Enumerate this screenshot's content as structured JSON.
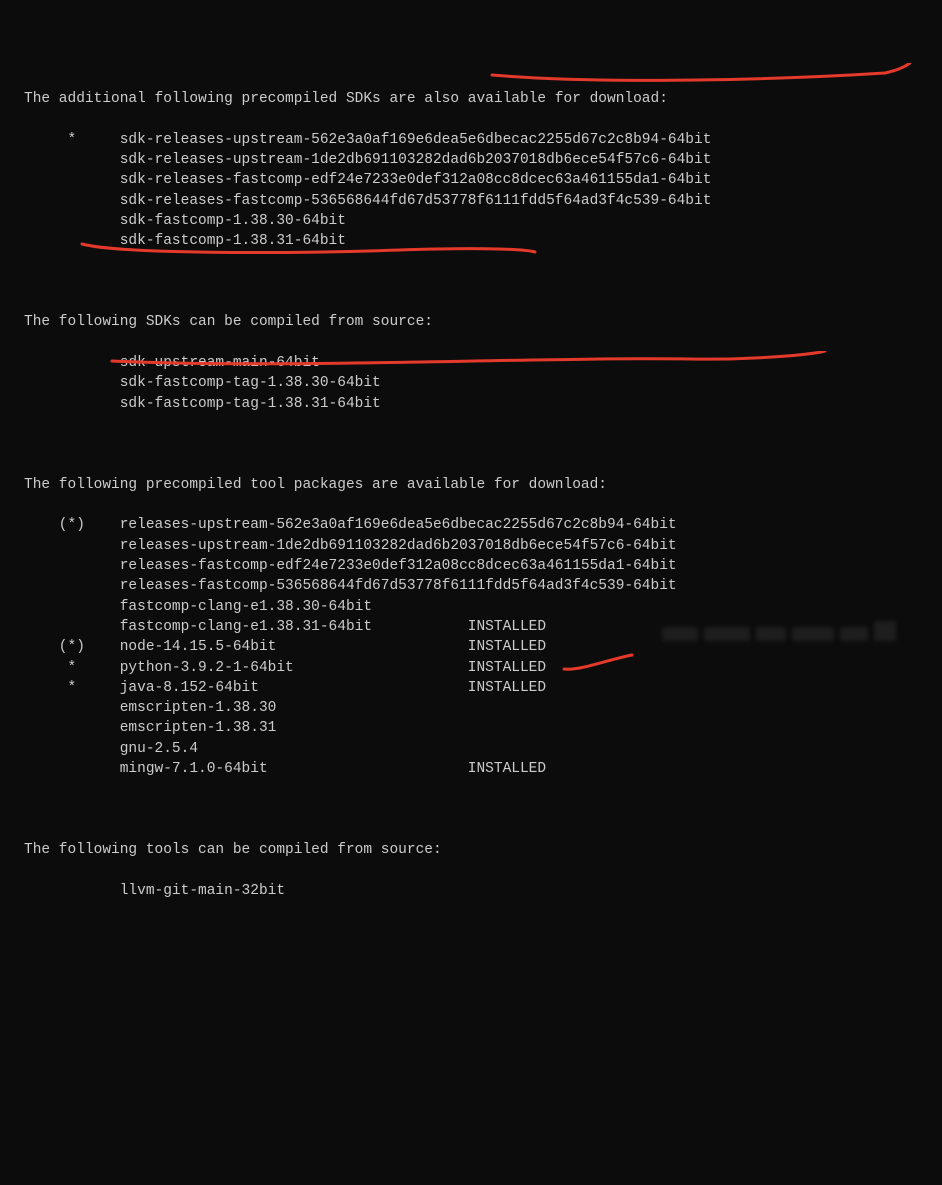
{
  "section1": {
    "heading": "The additional following precompiled SDKs are also available for download:",
    "rows": [
      {
        "marker": "     *     ",
        "text": "sdk-releases-upstream-562e3a0af169e6dea5e6dbecac2255d67c2c8b94-64bit"
      },
      {
        "marker": "           ",
        "text": "sdk-releases-upstream-1de2db691103282dad6b2037018db6ece54f57c6-64bit"
      },
      {
        "marker": "           ",
        "text": "sdk-releases-fastcomp-edf24e7233e0def312a08cc8dcec63a461155da1-64bit"
      },
      {
        "marker": "           ",
        "text": "sdk-releases-fastcomp-536568644fd67d53778f6111fdd5f64ad3f4c539-64bit"
      },
      {
        "marker": "           ",
        "text": "sdk-fastcomp-1.38.30-64bit"
      },
      {
        "marker": "           ",
        "text": "sdk-fastcomp-1.38.31-64bit"
      }
    ]
  },
  "section2": {
    "heading": "The following SDKs can be compiled from source:",
    "rows": [
      {
        "marker": "           ",
        "text": "sdk-upstream-main-64bit"
      },
      {
        "marker": "           ",
        "text": "sdk-fastcomp-tag-1.38.30-64bit"
      },
      {
        "marker": "           ",
        "text": "sdk-fastcomp-tag-1.38.31-64bit"
      }
    ]
  },
  "section3": {
    "heading": "The following precompiled tool packages are available for download:",
    "rows": [
      {
        "marker": "    (*)    ",
        "text": "releases-upstream-562e3a0af169e6dea5e6dbecac2255d67c2c8b94-64bit",
        "status": ""
      },
      {
        "marker": "           ",
        "text": "releases-upstream-1de2db691103282dad6b2037018db6ece54f57c6-64bit",
        "status": ""
      },
      {
        "marker": "           ",
        "text": "releases-fastcomp-edf24e7233e0def312a08cc8dcec63a461155da1-64bit",
        "status": ""
      },
      {
        "marker": "           ",
        "text": "releases-fastcomp-536568644fd67d53778f6111fdd5f64ad3f4c539-64bit",
        "status": ""
      },
      {
        "marker": "           ",
        "text": "fastcomp-clang-e1.38.30-64bit",
        "status": ""
      },
      {
        "marker": "           ",
        "text": "fastcomp-clang-e1.38.31-64bit           INSTALLED",
        "status": ""
      },
      {
        "marker": "    (*)    ",
        "text": "node-14.15.5-64bit                      INSTALLED",
        "status": ""
      },
      {
        "marker": "     *     ",
        "text": "python-3.9.2-1-64bit                    INSTALLED",
        "status": ""
      },
      {
        "marker": "     *     ",
        "text": "java-8.152-64bit                        INSTALLED",
        "status": ""
      },
      {
        "marker": "           ",
        "text": "emscripten-1.38.30",
        "status": ""
      },
      {
        "marker": "           ",
        "text": "emscripten-1.38.31",
        "status": ""
      },
      {
        "marker": "           ",
        "text": "gnu-2.5.4",
        "status": ""
      },
      {
        "marker": "           ",
        "text": "mingw-7.1.0-64bit                       INSTALLED",
        "status": ""
      }
    ]
  },
  "section4": {
    "heading": "The following tools can be compiled from source:",
    "rows": [
      {
        "marker": "           ",
        "text": "llvm-git-main-32bit"
      }
    ]
  }
}
